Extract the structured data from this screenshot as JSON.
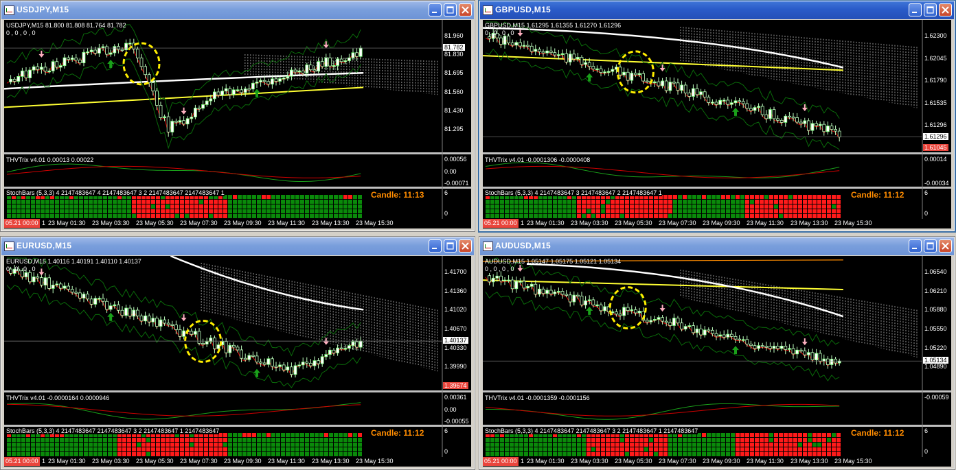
{
  "dates": [
    "23 May 01:30",
    "23 May 03:30",
    "23 May 05:30",
    "23 May 07:30",
    "23 May 09:30",
    "23 May 11:30",
    "23 May 13:30",
    "23 May 15:30"
  ],
  "date_start": "05.21 00:00",
  "colors": {
    "bull": "#1a8a1a",
    "bear": "#d00000",
    "yellow": "#ffff33",
    "white": "#ffffff",
    "candle_text": "#ff8c00"
  },
  "windows": [
    {
      "title": "USDJPY,M15",
      "header": "USDJPY,M15  81.800 81.808 81.764 81.782",
      "zeros": "0 , 0 , 0 , 0",
      "price_labels": [
        "81.960",
        "81.830",
        "81.695",
        "81.560",
        "81.430",
        "81.295"
      ],
      "current_price": "81.782",
      "thv": {
        "label": "THVTrix v4.01 0.00013 0.00022",
        "scale": [
          "0.00056",
          "0.00",
          "-0.00071"
        ]
      },
      "stoch": {
        "label": "StochBars (5,3,3) 4 2147483647 4 2147483647 3 2 2147483647 2147483647 1",
        "scale": [
          "6",
          "0"
        ]
      },
      "candle": "Candle:  11:13",
      "bot_label": "1"
    },
    {
      "title": "GBPUSD,M15",
      "header": "GBPUSD,M15  1.61295 1.61355 1.61270 1.61296",
      "zeros": "0 , 0 , 0 , 0",
      "price_labels": [
        "1.62300",
        "1.62045",
        "1.61790",
        "1.61535",
        "1.61296"
      ],
      "current_price": "1.61296",
      "red_price": "1.61045",
      "thv": {
        "label": "THVTrix v4.01 -0.0001306 -0.0000408",
        "scale": [
          "0.00014",
          "-0.00034"
        ]
      },
      "stoch": {
        "label": "StochBars (5,3,3) 4 2147483647 3 2147483647 2 2147483647 1",
        "scale": [
          "6",
          "0"
        ]
      },
      "candle": "Candle:  11:12",
      "bot_label": "1"
    },
    {
      "title": "EURUSD,M15",
      "header": "EURUSD,M15  1.40116 1.40191 1.40110 1.40137",
      "zeros": "0 , 0 , 0 , 0",
      "price_labels": [
        "1.41700",
        "1.41360",
        "1.41020",
        "1.40670",
        "1.40330",
        "1.39990"
      ],
      "current_price": "1.40137",
      "red_price": "1.39674",
      "thv": {
        "label": "THVTrix v4.01 -0.0000164 0.0000946",
        "scale": [
          "0.00361",
          "0.00",
          "-0.00055"
        ]
      },
      "stoch": {
        "label": "StochBars (5,3,3) 4 2147483647 2147483647 3 2 2147483647 1 2147483647",
        "scale": [
          "6",
          "0"
        ]
      },
      "candle": "Candle:  11:12",
      "bot_label": "1"
    },
    {
      "title": "AUDUSD,M15",
      "header": "AUDUSD,M15  1.05147 1.05175 1.05121 1.05134",
      "zeros": "0 , 0 , 0 , 0",
      "price_labels": [
        "1.06540",
        "1.06210",
        "1.05880",
        "1.05550",
        "1.05220",
        "1.04890"
      ],
      "current_price": "1.05134",
      "thv": {
        "label": "THVTrix v4.01 -0.0001359 -0.0001156",
        "scale": [
          "-0.00059"
        ]
      },
      "stoch": {
        "label": "StochBars (5,3,3) 4 2147483647 2147483647 3 2 2147483647 1 2147483647",
        "scale": [
          "6",
          "0"
        ]
      },
      "candle": "Candle:  11:12",
      "bot_label": "1"
    }
  ]
}
